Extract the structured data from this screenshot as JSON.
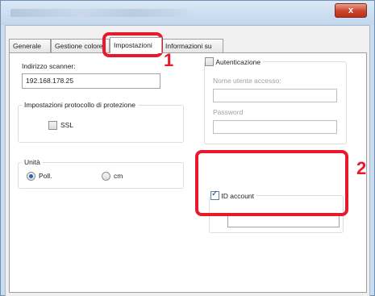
{
  "window": {
    "close_glyph": "x",
    "colors": {
      "titlebar": "#c9dcf0",
      "close": "#c9452b",
      "highlight": "#e8192c"
    }
  },
  "tabs": [
    {
      "label": "Generale",
      "active": false
    },
    {
      "label": "Gestione colore",
      "active": false
    },
    {
      "label": "Impostazioni",
      "active": true
    },
    {
      "label": "Informazioni su",
      "active": false
    }
  ],
  "scanner": {
    "address_label": "Indirizzo scanner:",
    "address_value": "192.168.178.25"
  },
  "protection": {
    "group_title": "Impostazioni protocollo di protezione",
    "ssl_label": "SSL",
    "ssl_checked": false
  },
  "units": {
    "group_title": "Unità",
    "options": [
      {
        "label": "Poll.",
        "selected": true
      },
      {
        "label": "cm",
        "selected": false
      }
    ]
  },
  "authentication": {
    "label": "Autenticazione",
    "checked": false,
    "username_label": "Nome utente accesso:",
    "username_value": "",
    "password_label": "Password",
    "password_value": ""
  },
  "account": {
    "label": "ID account",
    "checked": true,
    "value": ""
  },
  "callouts": {
    "first": "1",
    "second": "2"
  }
}
